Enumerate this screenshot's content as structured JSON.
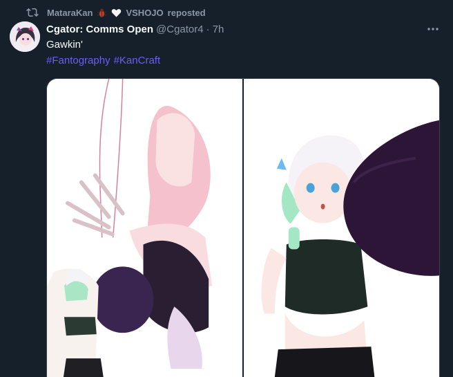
{
  "repost": {
    "user": "MataraKan",
    "org": "VSHOJO",
    "suffix": "reposted",
    "icon": "retweet-icon",
    "emojis": [
      "bug-emoji",
      "white-heart-emoji"
    ]
  },
  "tweet": {
    "display_name": "Cgator: Comms Open",
    "handle": "@Cgator4",
    "separator": "·",
    "time": "7h",
    "text": "Gawkin'",
    "hashtags": [
      "#Fantography",
      "#KanCraft"
    ],
    "more_icon": "more-horizontal-icon"
  },
  "media": {
    "images": [
      {
        "description_icon": "artwork-image-left"
      },
      {
        "description_icon": "artwork-image-right"
      }
    ]
  },
  "colors": {
    "background": "#15202b",
    "text_primary": "#f7f9f9",
    "text_secondary": "#8b98a5",
    "hashtag": "#6d5df5",
    "border": "#38444d"
  }
}
